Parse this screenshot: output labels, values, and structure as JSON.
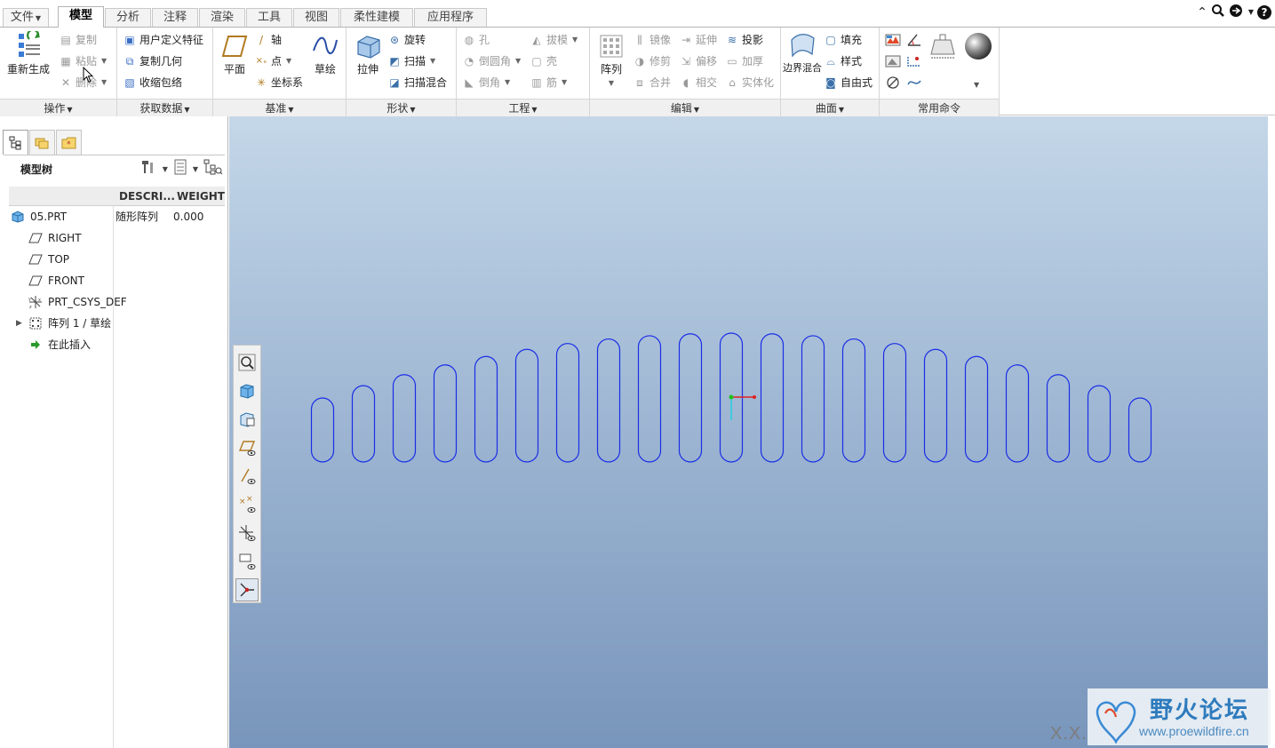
{
  "tabs": [
    {
      "label": "文件",
      "dropdown": true
    },
    {
      "label": "模型",
      "active": true
    },
    {
      "label": "分析"
    },
    {
      "label": "注释"
    },
    {
      "label": "渲染"
    },
    {
      "label": "工具"
    },
    {
      "label": "视图"
    },
    {
      "label": "柔性建模"
    },
    {
      "label": "应用程序"
    }
  ],
  "ribbon": {
    "operations": {
      "label": "操作",
      "regenerate": "重新生成",
      "copy": "复制",
      "paste": "粘贴",
      "delete": "删除"
    },
    "get_data": {
      "label": "获取数据",
      "udf": "用户定义特征",
      "copy_geom": "复制几何",
      "shrinkwrap": "收缩包络"
    },
    "datum": {
      "label": "基准",
      "plane": "平面",
      "axis": "轴",
      "point": "点",
      "csys": "坐标系",
      "sketch": "草绘"
    },
    "shapes": {
      "label": "形状",
      "extrude": "拉伸",
      "revolve": "旋转",
      "sweep": "扫描",
      "swept_blend": "扫描混合"
    },
    "engineering": {
      "label": "工程",
      "hole": "孔",
      "round": "倒圆角",
      "chamfer": "倒角",
      "draft": "拔模",
      "shell": "壳",
      "rib": "筋"
    },
    "editing": {
      "label": "编辑",
      "pattern": "阵列",
      "mirror": "镜像",
      "trim": "修剪",
      "merge": "合并",
      "extend": "延伸",
      "offset": "偏移",
      "intersect": "相交",
      "project": "投影",
      "thicken": "加厚",
      "solidify": "实体化"
    },
    "surfaces": {
      "label": "曲面",
      "boundary_blend": "边界混合",
      "fill": "填充",
      "style": "样式",
      "freestyle": "自由式"
    },
    "common": {
      "label": "常用命令"
    }
  },
  "model_tree": {
    "title": "模型树",
    "columns": [
      "DESCRI...",
      "WEIGHT"
    ],
    "rows": [
      {
        "name": "05.PRT",
        "desc": "随形阵列",
        "weight": "0.000",
        "icon": "part-icon"
      },
      {
        "name": "RIGHT",
        "desc": "",
        "weight": "",
        "icon": "datum-plane-icon"
      },
      {
        "name": "TOP",
        "desc": "",
        "weight": "",
        "icon": "datum-plane-icon"
      },
      {
        "name": "FRONT",
        "desc": "",
        "weight": "",
        "icon": "datum-plane-icon"
      },
      {
        "name": "PRT_CSYS_DEF",
        "desc": "",
        "weight": "",
        "icon": "csys-icon"
      },
      {
        "name": "阵列 1 / 草绘",
        "desc": "",
        "weight": "",
        "icon": "pattern-icon"
      },
      {
        "name": "在此插入",
        "desc": "",
        "weight": "",
        "icon": "insert-arrow-icon"
      }
    ]
  },
  "viewport": {
    "slot_count": 21,
    "slot_color": "#1a2ee6"
  },
  "watermark": {
    "title": "野火论坛",
    "url": "www.proewildfire.cn",
    "corner_text": "X.X."
  },
  "colors": {
    "accent": "#2e7bbd",
    "viewport_top": "#c4d7e8",
    "viewport_bottom": "#7895bb"
  }
}
